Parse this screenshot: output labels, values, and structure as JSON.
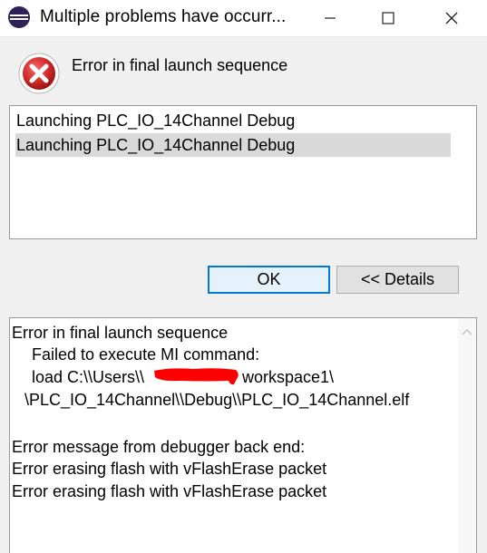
{
  "window": {
    "title": "Multiple problems have occurr...",
    "colors": {
      "titlebar": "#ffffff",
      "body": "#f0f0f0",
      "focus_border": "#0078d7",
      "error_red": "#d32a2a",
      "redaction": "#ff0000"
    }
  },
  "dialog": {
    "heading": "Error in final launch sequence",
    "list_items": [
      "Launching PLC_IO_14Channel Debug",
      "Launching PLC_IO_14Channel Debug"
    ],
    "selected_index": 1,
    "buttons": {
      "ok": "OK",
      "details": "<< Details"
    }
  },
  "details": {
    "lines": [
      "Error in final launch sequence",
      "Failed to execute MI command:",
      "load C:\\\\Users\\\\",
      "workspace1\\",
      "\\PLC_IO_14Channel\\\\Debug\\\\PLC_IO_14Channel.elf",
      "Error message from debugger back end:",
      "Error erasing flash with vFlashErase packet",
      "Error erasing flash with vFlashErase packet"
    ]
  }
}
